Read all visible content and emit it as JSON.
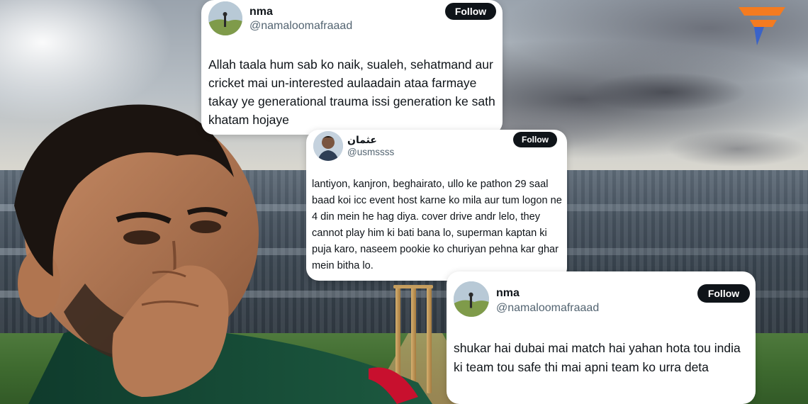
{
  "colors": {
    "card_background": "#ffffff",
    "follow_button": "#0f1419",
    "handle_text": "#536471",
    "brand_orange": "#f47b20",
    "brand_blue": "#3a63c9"
  },
  "brand": {
    "icon": "brand-logo-icon"
  },
  "tweets": [
    {
      "display_name": "nma",
      "handle": "@namaloomafraaad",
      "follow_label": "Follow",
      "avatar_icon": "avatar-landscape-icon",
      "text": "Allah taala hum sab ko naik, sualeh, sehatmand aur cricket mai un-interested aulaadain ataa farmaye takay ye generational trauma issi generation ke sath khatam hojaye"
    },
    {
      "display_name": "عثمان",
      "handle": "@usmssss",
      "follow_label": "Follow",
      "avatar_icon": "avatar-person-icon",
      "text": "lantiyon, kanjron, beghairato, ullo ke pathon 29 saal baad koi icc event host karne ko mila aur tum logon ne 4 din mein he hag diya. cover drive andr lelo, they cannot play him ki bati bana lo, superman kaptan ki puja karo, naseem pookie ko churiyan pehna kar ghar mein bitha lo."
    },
    {
      "display_name": "nma",
      "handle": "@namaloomafraaad",
      "follow_label": "Follow",
      "avatar_icon": "avatar-landscape-icon",
      "text": "shukar hai dubai mai match hai yahan hota tou india ki team tou safe thi mai apni team ko urra deta"
    }
  ]
}
